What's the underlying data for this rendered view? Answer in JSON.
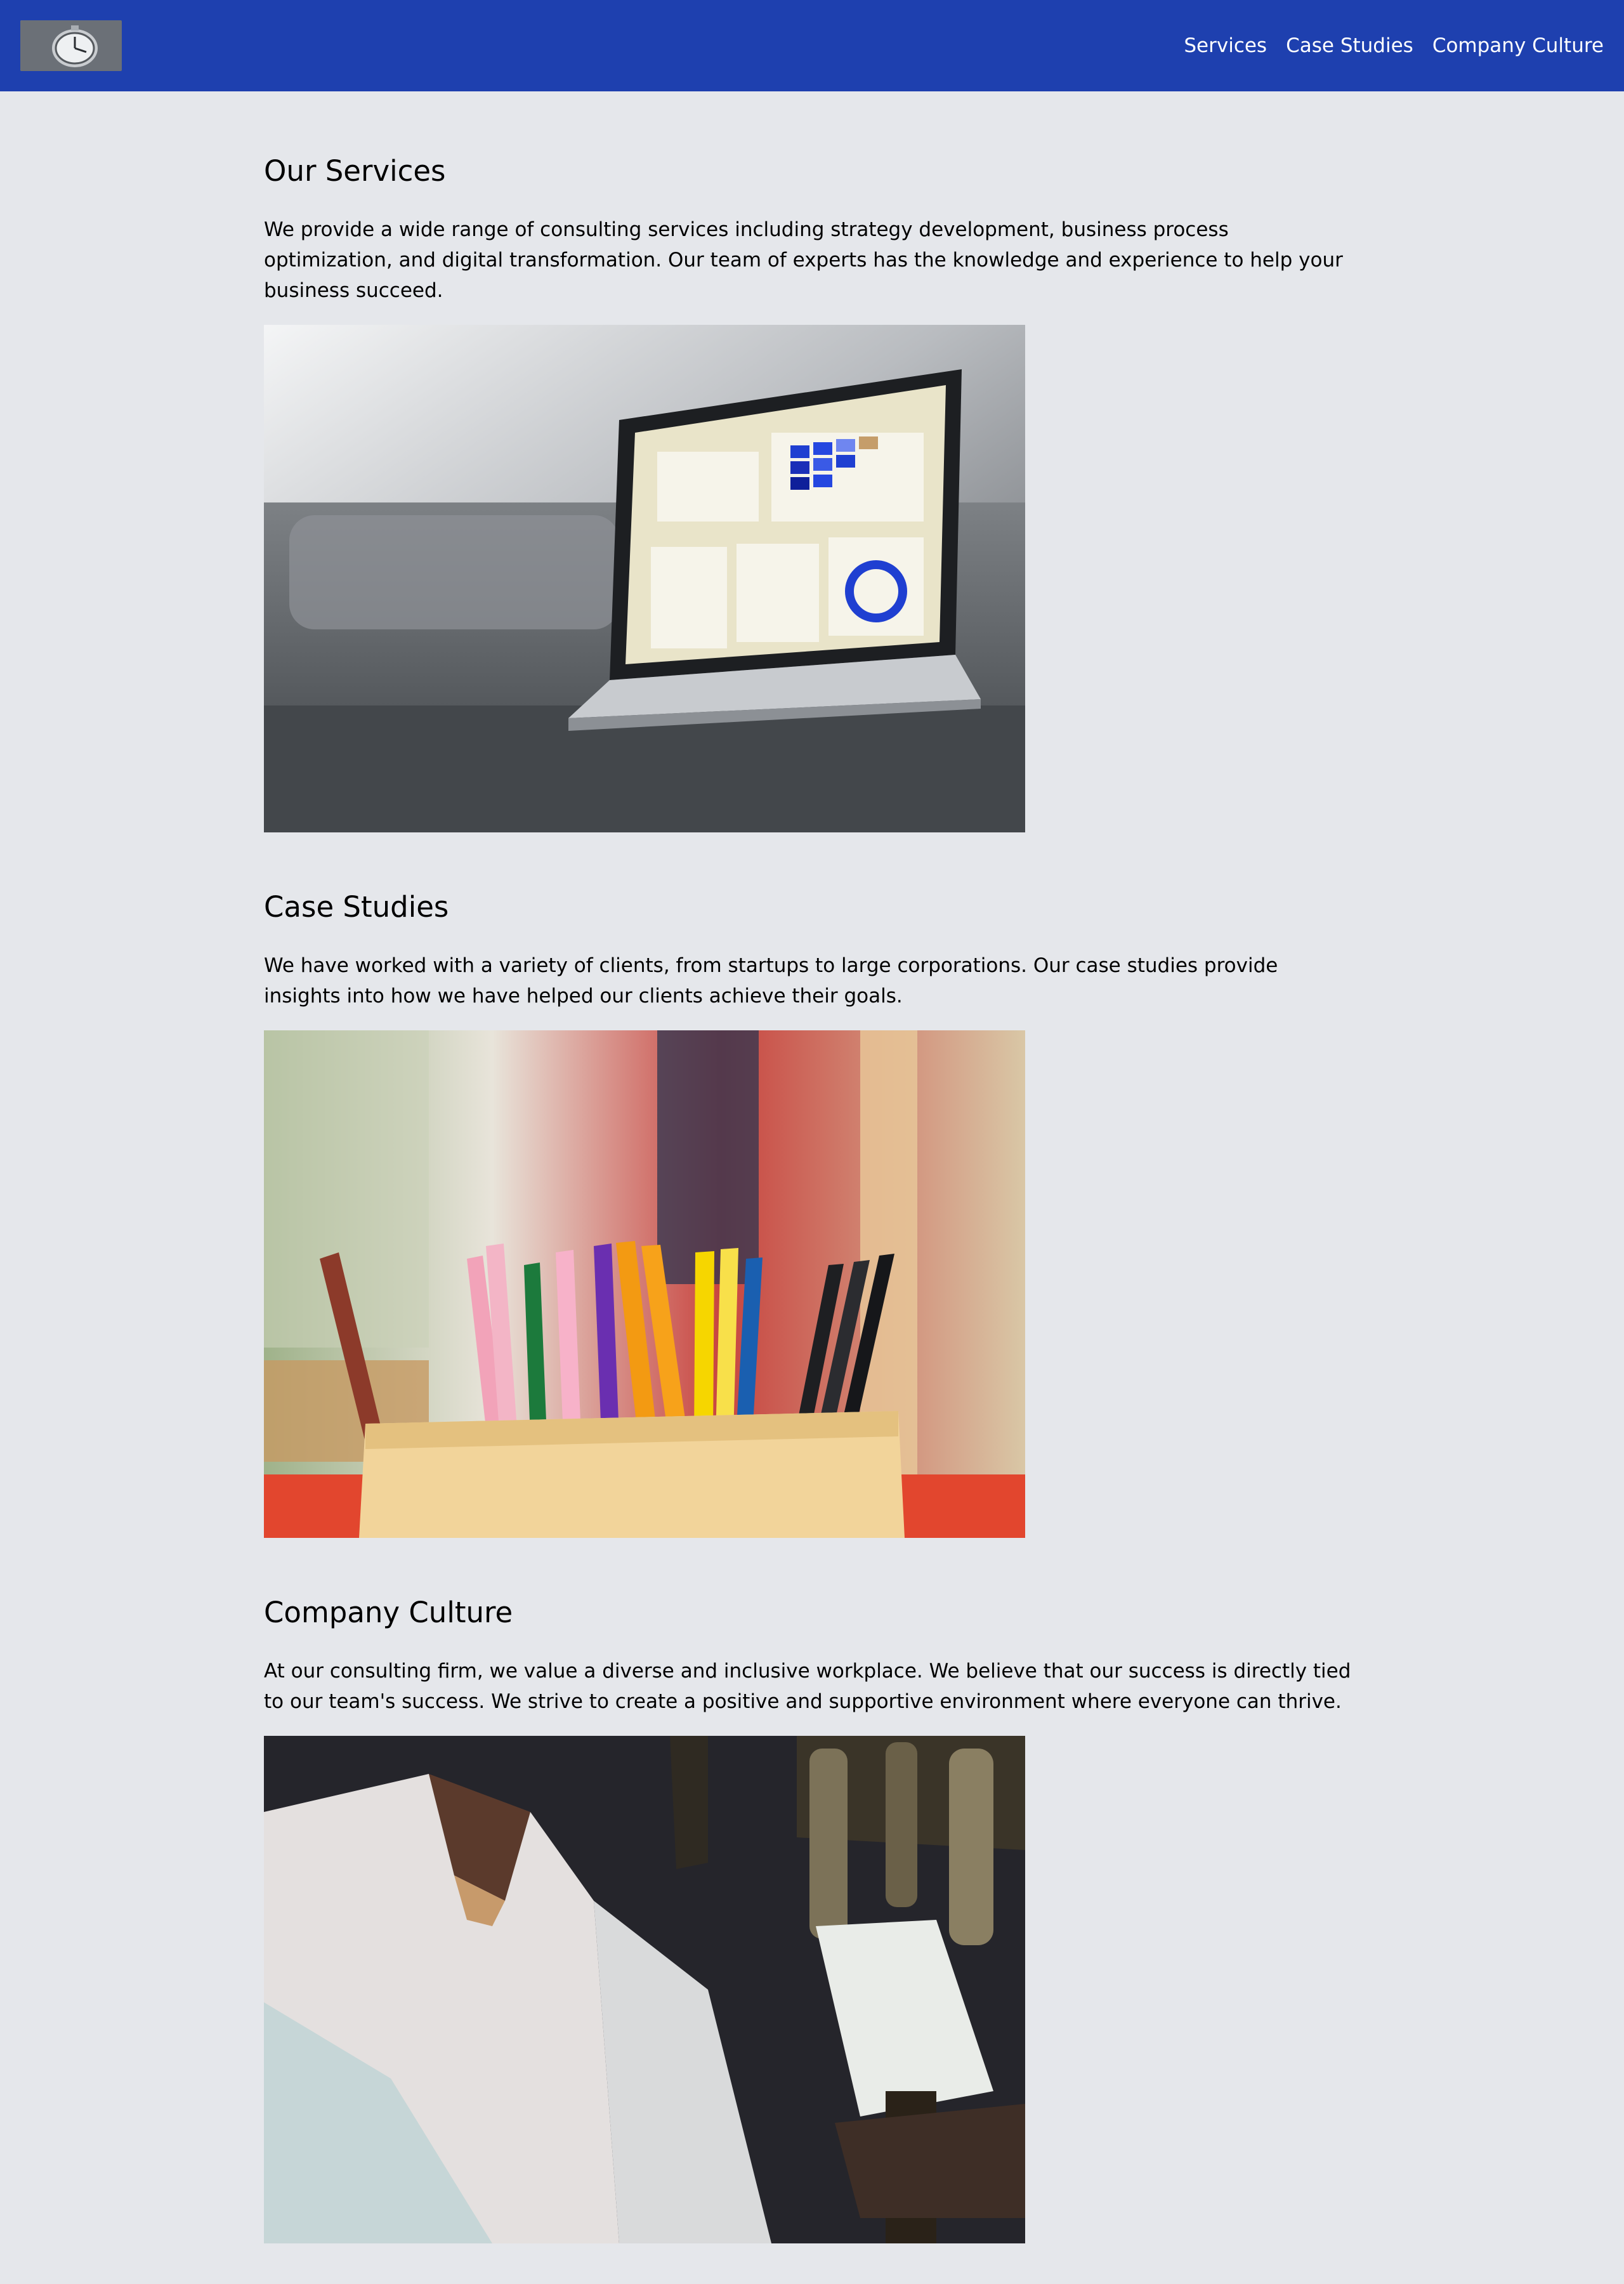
{
  "header": {
    "logo_icon": "clock-logo-icon",
    "nav": [
      {
        "label": "Services"
      },
      {
        "label": "Case Studies"
      },
      {
        "label": "Company Culture"
      }
    ],
    "colors": {
      "background": "#1e40af",
      "text": "#ffffff"
    }
  },
  "page": {
    "background": "#e5e7eb"
  },
  "sections": [
    {
      "title": "Our Services",
      "text": "We provide a wide range of consulting services including strategy development, business process optimization, and digital transformation. Our team of experts has the knowledge and experience to help your business succeed.",
      "image_icon": "laptop-dashboard-photo"
    },
    {
      "title": "Case Studies",
      "text": "We have worked with a variety of clients, from startups to large corporations. Our case studies provide insights into how we have helped our clients achieve their goals.",
      "image_icon": "colored-pencils-photo"
    },
    {
      "title": "Company Culture",
      "text": "At our consulting firm, we value a diverse and inclusive workplace. We believe that our success is directly tied to our team's success. We strive to create a positive and supportive environment where everyone can thrive.",
      "image_icon": "craftsman-tools-photo"
    }
  ]
}
